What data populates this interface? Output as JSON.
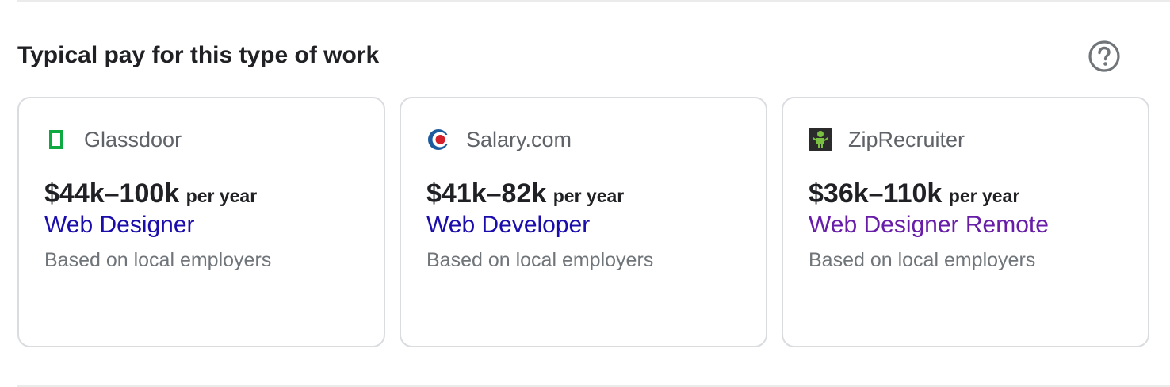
{
  "section": {
    "title": "Typical pay for this type of work",
    "help_icon": "help-circle-icon"
  },
  "cards": [
    {
      "source": "Glassdoor",
      "logo_icon": "glassdoor-logo-icon",
      "logo_color": "#0caa41",
      "pay_range": "$44k–100k",
      "pay_period": "per year",
      "job_title": "Web Designer",
      "job_title_color": "#1a0dab",
      "basis": "Based on local employers"
    },
    {
      "source": "Salary.com",
      "logo_icon": "salary-com-logo-icon",
      "logo_color": "#1d5b9f",
      "pay_range": "$41k–82k",
      "pay_period": "per year",
      "job_title": "Web Developer",
      "job_title_color": "#1a0dab",
      "basis": "Based on local employers"
    },
    {
      "source": "ZipRecruiter",
      "logo_icon": "ziprecruiter-logo-icon",
      "logo_color": "#5ba829",
      "pay_range": "$36k–110k",
      "pay_period": "per year",
      "job_title": "Web Designer Remote",
      "job_title_color": "#681da8",
      "basis": "Based on local employers"
    }
  ]
}
